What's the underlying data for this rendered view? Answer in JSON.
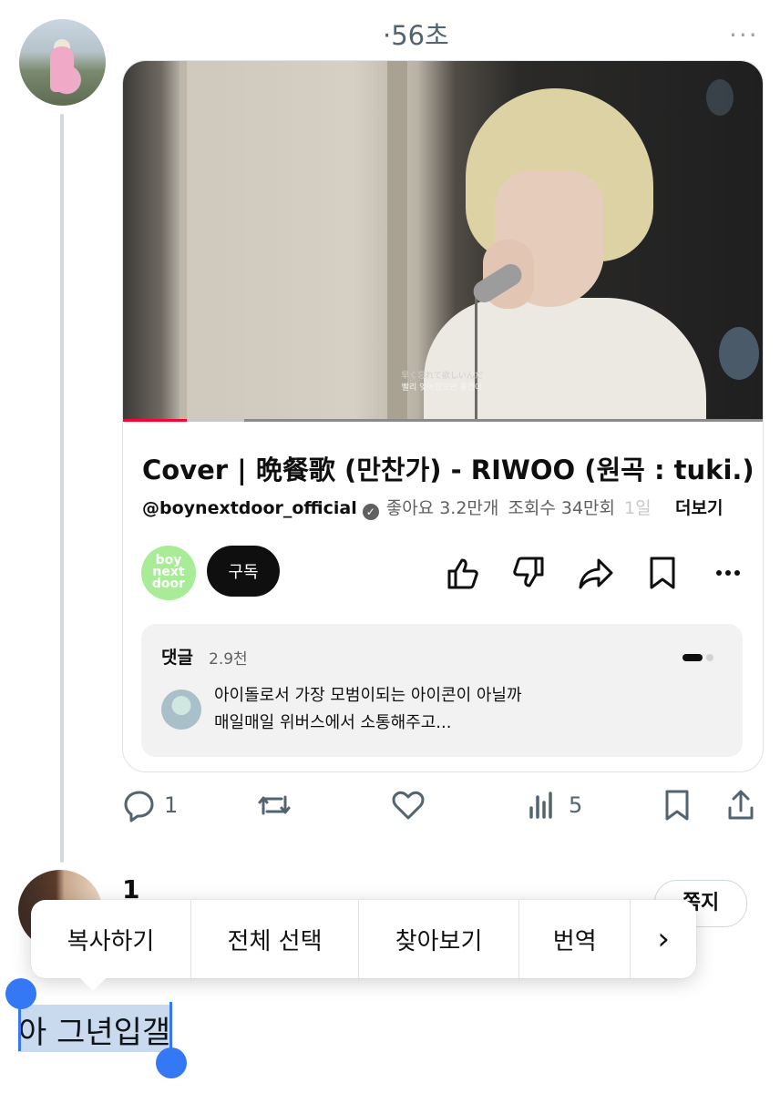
{
  "post": {
    "timestamp": "·56초",
    "more_icon": "···"
  },
  "video": {
    "subtitle_line1": "早く忘れて欲しいんだ",
    "subtitle_line2": "빨리 잊어줬으면 좋겠어",
    "progress_fraction": 0.1,
    "buffered_fraction": 0.19,
    "title": "Cover | 晩餐歌 (만찬가) - RIWOO (원곡 : tuki.)",
    "channel_handle": "@boynextdoor_official",
    "likes": "좋아요 3.2만개",
    "views": "조회수 34만회",
    "date_fragment": "1일",
    "more_label": "더보기",
    "channel_logo_text": "boy next door",
    "subscribe_label": "구독",
    "comments": {
      "title": "댓글",
      "count": "2.9천",
      "line1": "아이돌로서 가장 모범이되는 아이콘이 아닐까",
      "line2": "매일매일 위버스에서 소통해주고..."
    }
  },
  "actions": {
    "replies": "1",
    "views": "5"
  },
  "reply": {
    "name": "1",
    "dm_label": "쪽지"
  },
  "context_menu": {
    "items": [
      "복사하기",
      "전체 선택",
      "찾아보기",
      "번역"
    ],
    "next_arrow": "›"
  },
  "selected_text": "아 그년입갤",
  "colors": {
    "accent_blue": "#3478f6",
    "youtube_red": "#ff0033",
    "muted": "#536471"
  }
}
